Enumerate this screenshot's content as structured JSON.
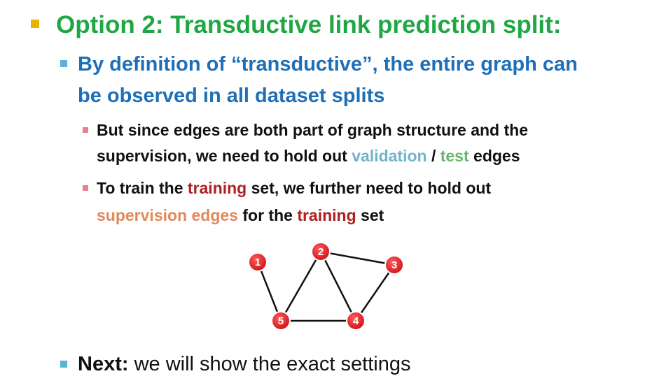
{
  "colors": {
    "level1_bullet": "#e6b400",
    "level1_text": "#1fa744",
    "level2_bullet": "#5bb2d8",
    "level2_text": "#1e6fb8",
    "level3_bullet": "#e8808a",
    "validation": "#73b3c9",
    "test": "#6ab56a",
    "training": "#b01e22",
    "supervision": "#e08a5a",
    "node_fill": "#e3191c"
  },
  "heading": {
    "text": "Option 2: Transductive link prediction split:"
  },
  "sub": {
    "line1": "By definition of “transductive”, the entire graph can",
    "line2": "be observed in all dataset splits"
  },
  "point1": {
    "line1": "But since edges are both part of graph structure and the",
    "line2_pre": "supervision, we need to hold out ",
    "validation": "validation",
    "slash": " / ",
    "test": "test",
    "line2_post": " edges"
  },
  "point2": {
    "line1_pre": "To train the ",
    "training": "training",
    "line1_post": " set, we further need to hold out",
    "supervision": "supervision edges",
    "line2_mid": " for the ",
    "training2": "training",
    "line2_post": " set"
  },
  "graph": {
    "nodes": [
      "1",
      "2",
      "3",
      "4",
      "5"
    ],
    "edges": [
      [
        "1",
        "5"
      ],
      [
        "5",
        "2"
      ],
      [
        "2",
        "3"
      ],
      [
        "2",
        "4"
      ],
      [
        "3",
        "4"
      ],
      [
        "5",
        "4"
      ]
    ]
  },
  "next": {
    "label": "Next:",
    "text": " we will show the exact settings"
  }
}
